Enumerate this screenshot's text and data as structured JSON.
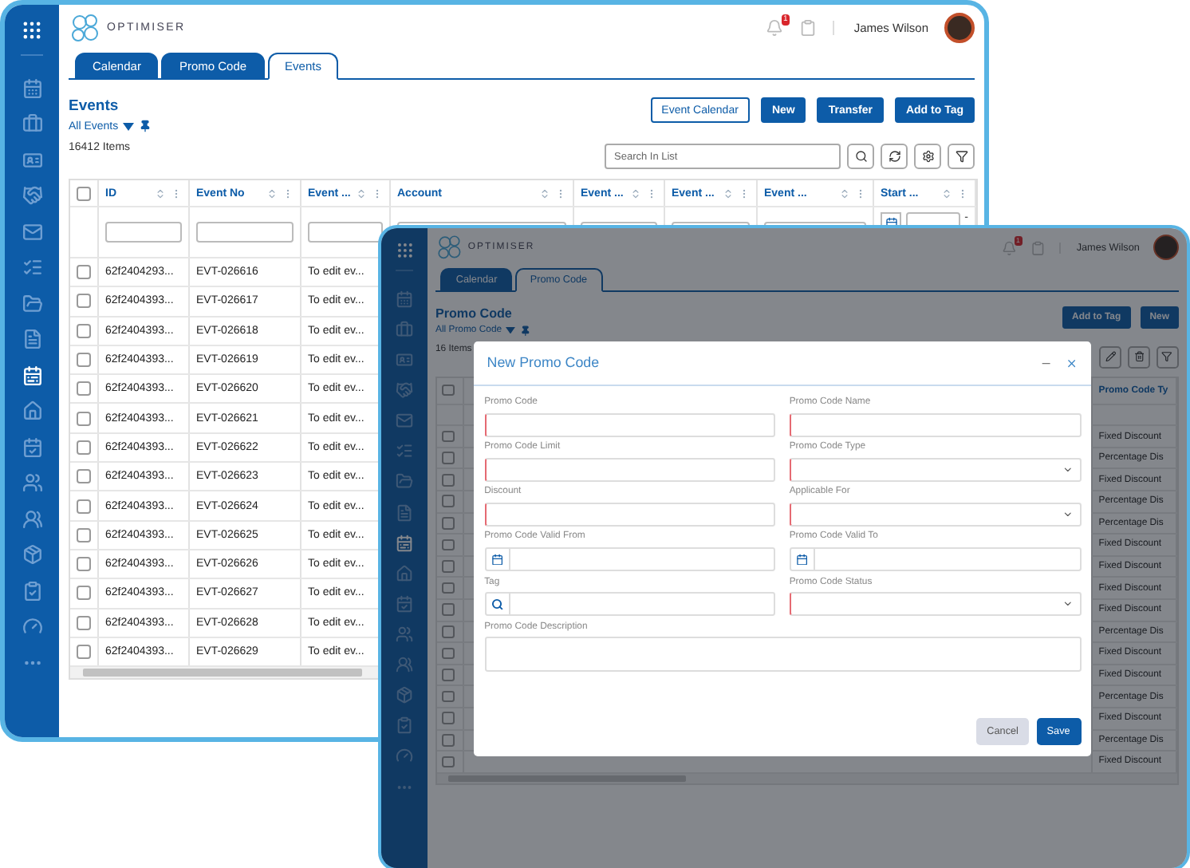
{
  "events_window": {
    "sidebar": [
      {
        "selected": false
      },
      {
        "selected": false
      },
      {
        "selected": false
      },
      {
        "selected": false
      },
      {
        "selected": false
      },
      {
        "selected": false
      },
      {
        "selected": false
      },
      {
        "selected": false
      },
      {
        "selected": true
      },
      {
        "selected": false
      },
      {
        "selected": false
      },
      {
        "selected": false
      },
      {
        "selected": false
      },
      {
        "selected": false
      },
      {
        "selected": false
      },
      {
        "selected": false
      },
      {
        "selected": false
      }
    ],
    "logo": "OPTIMISER",
    "notification_count": "1",
    "user_name": "James Wilson",
    "tabs": [
      {
        "label": "Calendar",
        "selected": false
      },
      {
        "label": "Promo Code",
        "selected": false
      },
      {
        "label": "Events",
        "selected": true
      }
    ],
    "title": "Events",
    "view": "All Events",
    "item_count": "16412 Items",
    "actions": [
      {
        "label": "Event Calendar",
        "kind": "outline"
      },
      {
        "label": "New",
        "kind": "primary"
      },
      {
        "label": "Transfer",
        "kind": "primary"
      },
      {
        "label": "Add to Tag",
        "kind": "primary"
      }
    ],
    "search": {
      "placeholder": "Search In List"
    },
    "table": {
      "columns": [
        "ID",
        "Event No",
        "Event ...",
        "Account",
        "Event ...",
        "Event ...",
        "Event ...",
        "Start ..."
      ],
      "filter_separator": "-",
      "all_selected": false,
      "rows": [
        {
          "id": "62f2404293...",
          "event_no": "EVT-026616",
          "event": "To edit ev...",
          "checked": false
        },
        {
          "id": "62f2404393...",
          "event_no": "EVT-026617",
          "event": "To edit ev...",
          "checked": false
        },
        {
          "id": "62f2404393...",
          "event_no": "EVT-026618",
          "event": "To edit ev...",
          "checked": false
        },
        {
          "id": "62f2404393...",
          "event_no": "EVT-026619",
          "event": "To edit ev...",
          "checked": false
        },
        {
          "id": "62f2404393...",
          "event_no": "EVT-026620",
          "event": "To edit ev...",
          "checked": false
        },
        {
          "id": "62f2404393...",
          "event_no": "EVT-026621",
          "event": "To edit ev...",
          "checked": false
        },
        {
          "id": "62f2404393...",
          "event_no": "EVT-026622",
          "event": "To edit ev...",
          "checked": false
        },
        {
          "id": "62f2404393...",
          "event_no": "EVT-026623",
          "event": "To edit ev...",
          "checked": false
        },
        {
          "id": "62f2404393...",
          "event_no": "EVT-026624",
          "event": "To edit ev...",
          "checked": false
        },
        {
          "id": "62f2404393...",
          "event_no": "EVT-026625",
          "event": "To edit ev...",
          "checked": false
        },
        {
          "id": "62f2404393...",
          "event_no": "EVT-026626",
          "event": "To edit ev...",
          "checked": false
        },
        {
          "id": "62f2404393...",
          "event_no": "EVT-026627",
          "event": "To edit ev...",
          "checked": false
        },
        {
          "id": "62f2404393...",
          "event_no": "EVT-026628",
          "event": "To edit ev...",
          "checked": false
        },
        {
          "id": "62f2404393...",
          "event_no": "EVT-026629",
          "event": "To edit ev...",
          "checked": false
        }
      ]
    }
  },
  "promo_window": {
    "sidebar": [
      {
        "selected": false
      },
      {
        "selected": false
      },
      {
        "selected": false
      },
      {
        "selected": false
      },
      {
        "selected": false
      },
      {
        "selected": false
      },
      {
        "selected": false
      },
      {
        "selected": false
      },
      {
        "selected": true
      },
      {
        "selected": false
      },
      {
        "selected": false
      },
      {
        "selected": false
      },
      {
        "selected": false
      },
      {
        "selected": false
      },
      {
        "selected": false
      },
      {
        "selected": false
      },
      {
        "selected": false
      }
    ],
    "logo": "OPTIMISER",
    "notification_count": "1",
    "user_name": "James Wilson",
    "tabs": [
      {
        "label": "Calendar",
        "selected": false
      },
      {
        "label": "Promo Code",
        "selected": true
      }
    ],
    "title": "Promo Code",
    "view": "All Promo Code",
    "item_count": "16 Items",
    "actions": [
      {
        "label": "Add to Tag",
        "kind": "primary"
      },
      {
        "label": "New",
        "kind": "primary"
      }
    ],
    "table": {
      "columns": [
        "Promo Code Ty"
      ],
      "all_selected": false,
      "rows": [
        {
          "promo_code_type": "Fixed Discount",
          "checked": false
        },
        {
          "promo_code_type": "Percentage Dis",
          "checked": false
        },
        {
          "promo_code_type": "Fixed Discount",
          "checked": false
        },
        {
          "promo_code_type": "Percentage Dis",
          "checked": false
        },
        {
          "promo_code_type": "Percentage Dis",
          "checked": false
        },
        {
          "promo_code_type": "Fixed Discount",
          "checked": false
        },
        {
          "promo_code_type": "Fixed Discount",
          "checked": false
        },
        {
          "promo_code_type": "Fixed Discount",
          "checked": false
        },
        {
          "promo_code_type": "Fixed Discount",
          "checked": false
        },
        {
          "promo_code_type": "Percentage Dis",
          "checked": false
        },
        {
          "promo_code_type": "Fixed Discount",
          "checked": false
        },
        {
          "promo_code_type": "Fixed Discount",
          "checked": false
        },
        {
          "promo_code_type": "Percentage Dis",
          "checked": false
        },
        {
          "promo_code_type": "Fixed Discount",
          "checked": false
        },
        {
          "promo_code_type": "Percentage Dis",
          "checked": false
        },
        {
          "promo_code_type": "Fixed Discount",
          "checked": false
        }
      ]
    },
    "modal": {
      "title": "New Promo Code",
      "fields": [
        {
          "label": "Promo Code",
          "kind": "text",
          "required": true
        },
        {
          "label": "Promo Code Name",
          "kind": "text",
          "required": true
        },
        {
          "label": "Promo Code Limit",
          "kind": "text",
          "required": true
        },
        {
          "label": "Promo Code Type",
          "kind": "select",
          "required": true
        },
        {
          "label": "Discount",
          "kind": "text",
          "required": true
        },
        {
          "label": "Applicable For",
          "kind": "select",
          "required": true
        },
        {
          "label": "Promo Code Valid From",
          "kind": "date",
          "required": false
        },
        {
          "label": "Promo Code Valid To",
          "kind": "date",
          "required": false
        },
        {
          "label": "Tag",
          "kind": "lookup",
          "required": false
        },
        {
          "label": "Promo Code Status",
          "kind": "select",
          "required": true
        },
        {
          "label": "Promo Code Description",
          "kind": "textarea",
          "required": false
        }
      ],
      "buttons": [
        {
          "label": "Cancel",
          "kind": "secondary"
        },
        {
          "label": "Save",
          "kind": "primary"
        }
      ]
    }
  }
}
